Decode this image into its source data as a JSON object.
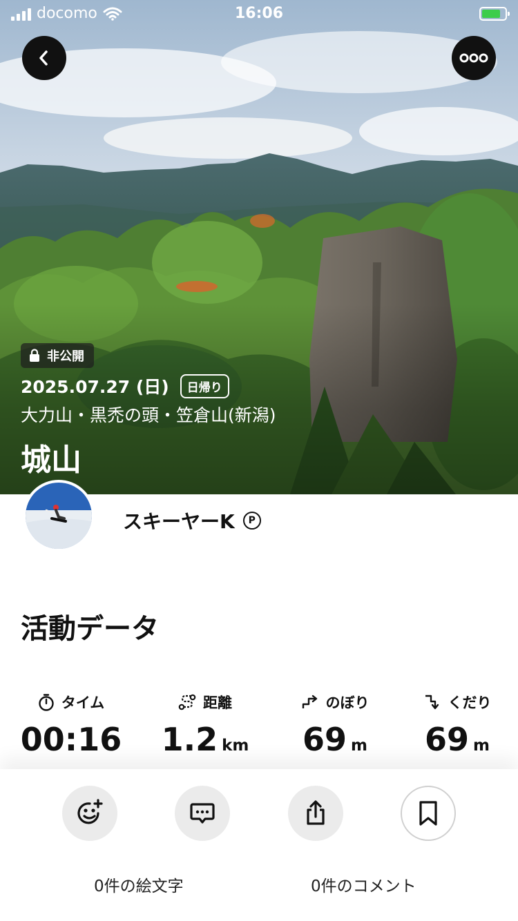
{
  "status_bar": {
    "carrier": "docomo",
    "time": "16:06"
  },
  "hero": {
    "private_label": "非公開",
    "date": "2025.07.27 (日)",
    "trip_type": "日帰り",
    "area": "大力山・黒禿の頭・笠倉山(新潟)",
    "mountain_name": "城山"
  },
  "user": {
    "name": "スキーヤーK",
    "badge": "P"
  },
  "activity": {
    "title": "活動データ",
    "stats": [
      {
        "icon": "stopwatch-icon",
        "label": "タイム",
        "value": "00:16",
        "unit": ""
      },
      {
        "icon": "route-icon",
        "label": "距離",
        "value": "1.2",
        "unit": "km"
      },
      {
        "icon": "ascent-icon",
        "label": "のぼり",
        "value": "69",
        "unit": "m"
      },
      {
        "icon": "descent-icon",
        "label": "くだり",
        "value": "69",
        "unit": "m"
      }
    ]
  },
  "actions": {
    "emoji_count": "0件の絵文字",
    "comment_count": "0件のコメント"
  },
  "colors": {
    "battery": "#3ccd4b",
    "button_dark": "#111111",
    "action_bg": "#ebebeb"
  }
}
